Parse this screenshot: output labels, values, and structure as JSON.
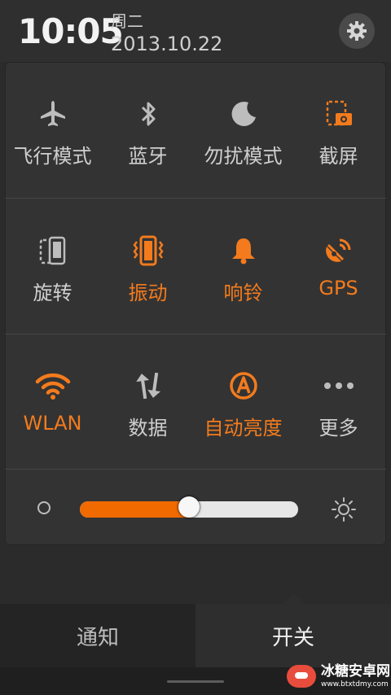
{
  "status": {
    "time": "10:05",
    "weekday": "周二",
    "date": "2013.10.22"
  },
  "colors": {
    "accent": "#f37b1d",
    "inactive": "#cfcfcf",
    "panel": "#333333"
  },
  "toggles": [
    [
      {
        "label": "飞行模式",
        "icon": "airplane-icon",
        "active": false
      },
      {
        "label": "蓝牙",
        "icon": "bluetooth-icon",
        "active": false
      },
      {
        "label": "勿扰模式",
        "icon": "moon-icon",
        "active": false
      },
      {
        "label": "截屏",
        "icon": "screenshot-icon",
        "active": false
      }
    ],
    [
      {
        "label": "旋转",
        "icon": "rotate-icon",
        "active": false
      },
      {
        "label": "振动",
        "icon": "vibrate-icon",
        "active": true
      },
      {
        "label": "响铃",
        "icon": "bell-icon",
        "active": true
      },
      {
        "label": "GPS",
        "icon": "gps-icon",
        "active": true
      }
    ],
    [
      {
        "label": "WLAN",
        "icon": "wifi-icon",
        "active": true
      },
      {
        "label": "数据",
        "icon": "data-icon",
        "active": false
      },
      {
        "label": "自动亮度",
        "icon": "auto-brightness-icon",
        "active": true
      },
      {
        "label": "更多",
        "icon": "more-icon",
        "active": false
      }
    ]
  ],
  "brightness": {
    "level": 0.5
  },
  "tabs": {
    "notifications": "通知",
    "switches": "开关",
    "selected": "switches"
  },
  "watermark": {
    "name": "冰糖安卓网",
    "url": "www.btxtdmy.com"
  }
}
